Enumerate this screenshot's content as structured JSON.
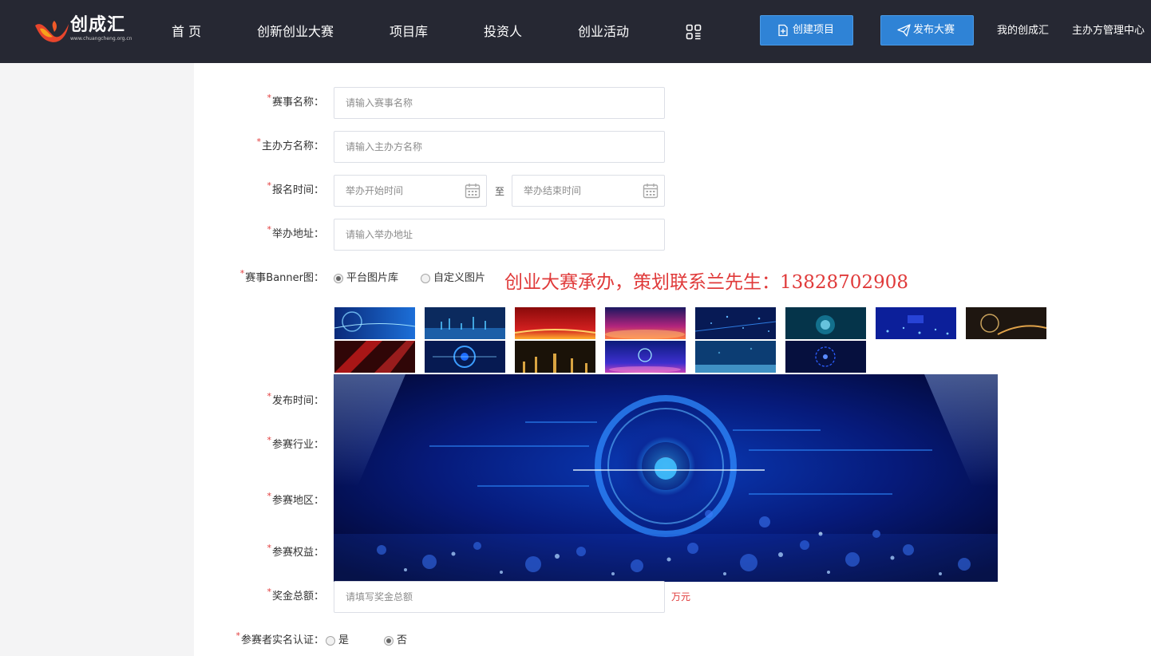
{
  "header": {
    "logo_text": "创成汇",
    "logo_url": "www.chuangcheng.org.cn",
    "nav": [
      {
        "label": "首 页"
      },
      {
        "label": "创新创业大赛"
      },
      {
        "label": "项目库"
      },
      {
        "label": "投资人"
      },
      {
        "label": "创业活动"
      }
    ],
    "create_project_label": "创建项目",
    "publish_contest_label": "发布大赛",
    "my_account_label": "我的创成汇",
    "organizer_center_label": "主办方管理中心"
  },
  "form": {
    "contest_name": {
      "label": "赛事名称：",
      "placeholder": "请输入赛事名称",
      "value": ""
    },
    "organizer_name": {
      "label": "主办方名称：",
      "placeholder": "请输入主办方名称",
      "value": ""
    },
    "signup_time": {
      "label": "报名时间：",
      "start_placeholder": "举办开始时间",
      "end_placeholder": "举办结束时间",
      "separator": "至"
    },
    "address": {
      "label": "举办地址：",
      "placeholder": "请输入举办地址",
      "value": ""
    },
    "banner": {
      "label": "赛事Banner图：",
      "options": [
        {
          "label": "平台图片库",
          "selected": true
        },
        {
          "label": "自定义图片",
          "selected": false
        }
      ],
      "selected_thumb": 9
    },
    "promo_text": "创业大赛承办，策划联系兰先生：13828702908",
    "publish_time": {
      "label": "发布时间："
    },
    "industry": {
      "label": "参赛行业："
    },
    "region": {
      "label": "参赛地区："
    },
    "benefits": {
      "label": "参赛权益："
    },
    "prize_total": {
      "label": "奖金总额：",
      "placeholder": "请填写奖金总额",
      "unit": "万元"
    },
    "realname": {
      "label": "参赛者实名认证：",
      "options": [
        {
          "label": "是",
          "selected": false
        },
        {
          "label": "否",
          "selected": true
        }
      ]
    }
  },
  "theme": {
    "header_bg": "#262833",
    "button_blue": "#2f83d6",
    "required_red": "#e23b3b",
    "promo_red": "#e03a3a"
  }
}
